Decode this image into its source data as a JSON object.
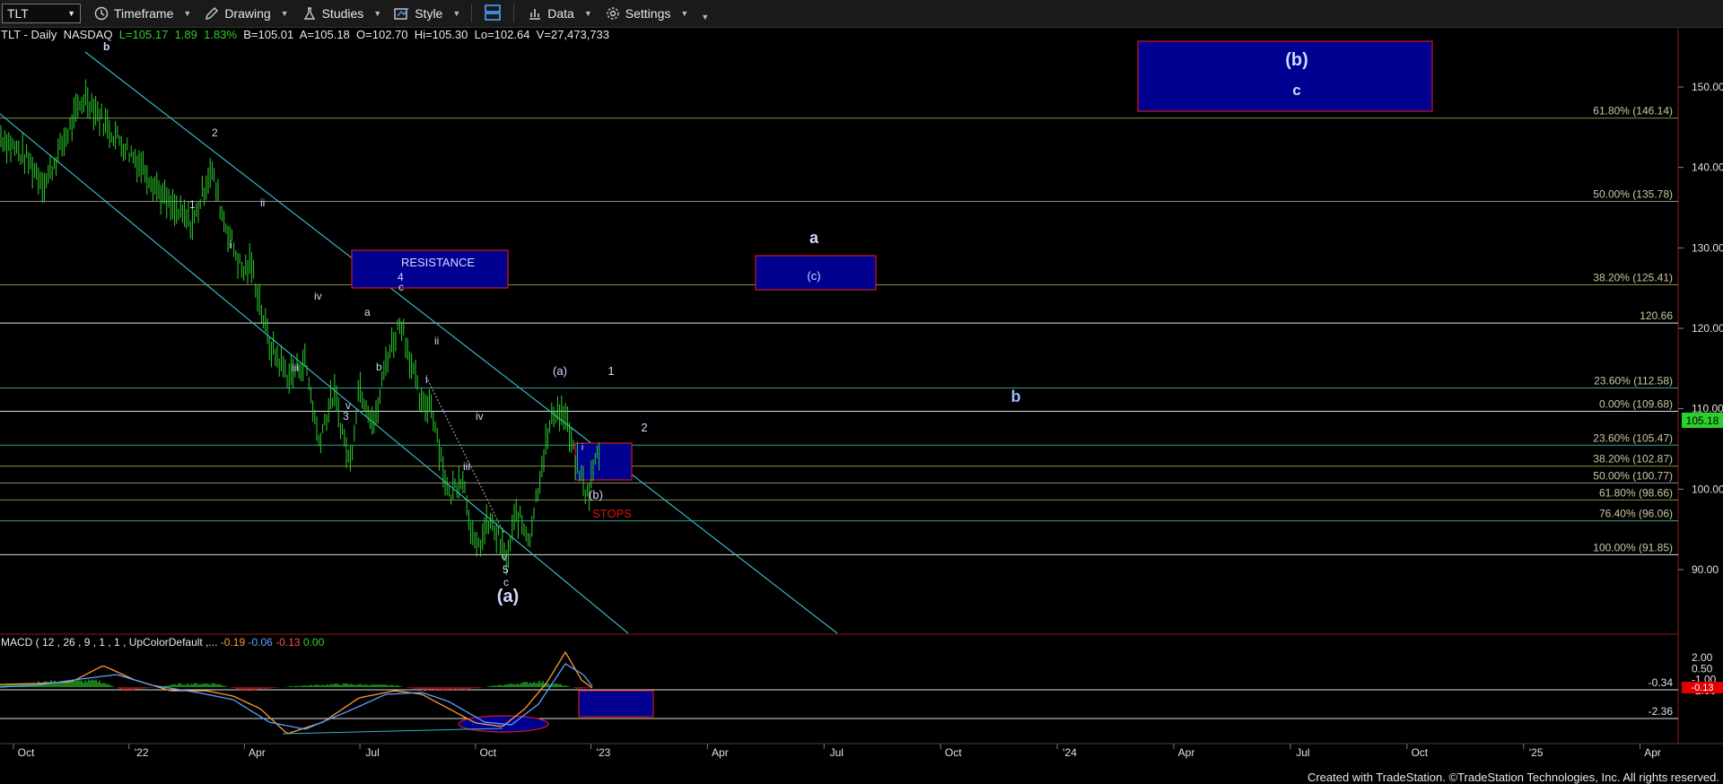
{
  "toolbar": {
    "symbol": "TLT",
    "timeframe_label": "Timeframe",
    "drawing_label": "Drawing",
    "studies_label": "Studies",
    "style_label": "Style",
    "data_label": "Data",
    "settings_label": "Settings"
  },
  "chart_header": {
    "symbol": "TLT - Daily",
    "exchange": "NASDAQ",
    "last": "L=105.17",
    "change": "1.89",
    "change_pct": "1.83%",
    "bid": "B=105.01",
    "ask": "A=105.18",
    "open": "O=102.70",
    "high": "Hi=105.30",
    "low": "Lo=102.64",
    "volume": "V=27,473,733"
  },
  "price_axis": {
    "ticks": [
      "150.00",
      "140.00",
      "130.00",
      "120.00",
      "110.00",
      "100.00",
      "90.00"
    ],
    "current_price": "105.18"
  },
  "macd_axis": {
    "ticks": [
      "2.00",
      "0.50",
      "-1.00",
      "-2.50"
    ],
    "current_value": "-0.13",
    "ref_upper": "-0.34",
    "ref_lower": "-2.36"
  },
  "time_axis": {
    "labels": [
      "Oct",
      "'22",
      "Apr",
      "Jul",
      "Oct",
      "'23",
      "Apr",
      "Jul",
      "Oct",
      "'24",
      "Apr",
      "Jul",
      "Oct",
      "'25",
      "Apr"
    ]
  },
  "fib_levels": [
    {
      "label": "61.80% (146.14)",
      "color": "#8b8b3a"
    },
    {
      "label": "50.00% (135.78)",
      "color": "#8a8a8a"
    },
    {
      "label": "38.20% (125.41)",
      "color": "#8b8b3a"
    },
    {
      "label": "120.66",
      "color": "#e0e0e0"
    },
    {
      "label": "23.60% (112.58)",
      "color": "#2aa88a"
    },
    {
      "label": "0.00% (109.68)",
      "color": "#e0e0e0"
    },
    {
      "label": "23.60% (105.47)",
      "color": "#2aa88a"
    },
    {
      "label": "38.20% (102.87)",
      "color": "#8b8b3a"
    },
    {
      "label": "50.00% (100.77)",
      "color": "#8a8a8a"
    },
    {
      "label": "61.80% (98.66)",
      "color": "#8b8b3a"
    },
    {
      "label": "76.40% (96.06)",
      "color": "#2aa88a"
    },
    {
      "label": "100.00% (91.85)",
      "color": "#e0e0e0"
    }
  ],
  "annotations": {
    "resistance": "RESISTANCE",
    "stops": "STOPS",
    "box_c": "(c)",
    "big_b": "(b)",
    "big_c": "c",
    "label_a_upper": "a",
    "label_b_right": "b",
    "label_a_paren": "(a)",
    "label_a_paren_small": "(a)",
    "label_b_paren_small": "(b)",
    "label_1": "1",
    "label_2": "2",
    "label_i_small": "i",
    "wave_labels": {
      "top_b": "b",
      "w2": "2",
      "w1": "1",
      "wi": "i",
      "wii": "ii",
      "wiii": "iii",
      "wiv": "iv",
      "wv3": "v",
      "w3": "3",
      "wa": "a",
      "wb": "b",
      "w4": "4",
      "wc": "c",
      "wii2": "ii",
      "wi2": "i",
      "wiv2": "iv",
      "wiii2": "iii",
      "wv": "v",
      "w5": "5",
      "wc2": "c"
    }
  },
  "macd": {
    "title": "MACD ( 12 , 26 , 9 , 1 , 1 , UpColorDefault ,...",
    "v1": "-0.19",
    "v2": "-0.06",
    "v3": "-0.13",
    "v4": "0.00"
  },
  "footer": "Created with TradeStation. ©TradeStation Technologies, Inc. All rights reserved.",
  "colors": {
    "accent_box_fill": "#000090",
    "accent_box_border": "#d01818",
    "channel": "#35b6c8",
    "price_bars": "#2bd12b",
    "resistance_text": "#d8d8ff",
    "stops_text": "#e01010",
    "wave_text": "#cfd8ff"
  }
}
